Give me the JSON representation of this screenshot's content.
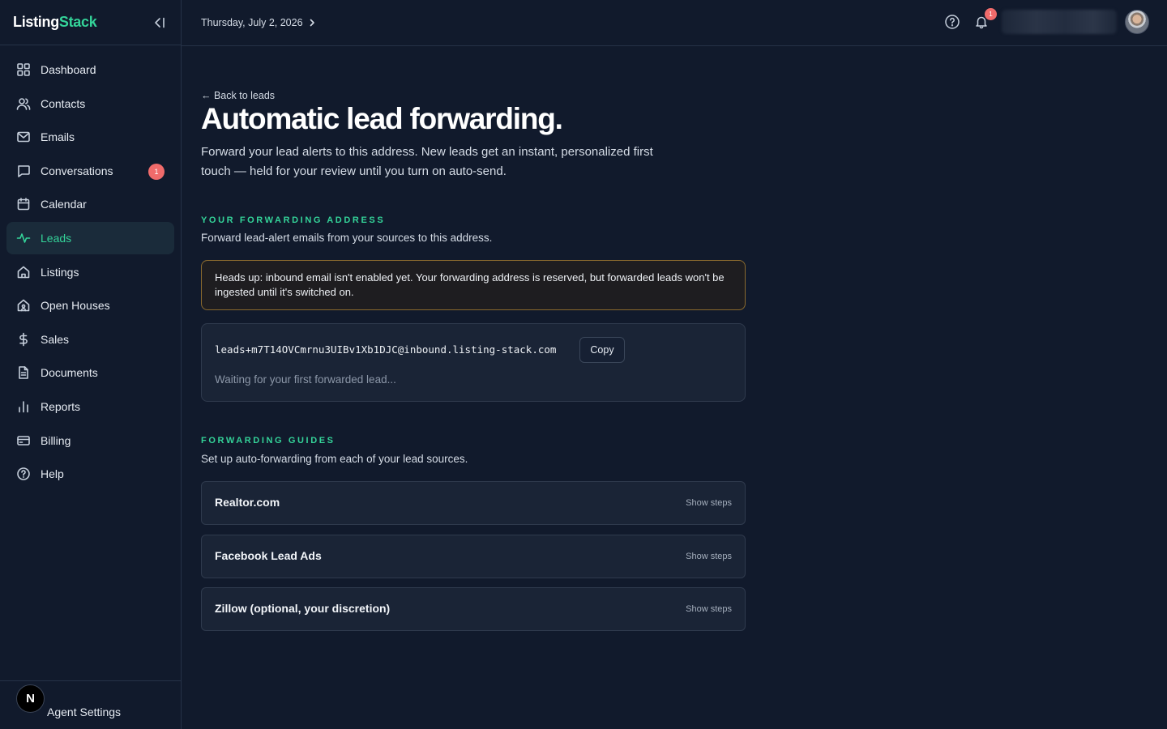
{
  "app": {
    "brand_part1": "Listing",
    "brand_part2": "Stack"
  },
  "sidebar": {
    "items": [
      {
        "label": "Dashboard",
        "icon": "grid-icon"
      },
      {
        "label": "Contacts",
        "icon": "users-icon"
      },
      {
        "label": "Emails",
        "icon": "mail-icon"
      },
      {
        "label": "Conversations",
        "icon": "chat-icon",
        "badge": "1"
      },
      {
        "label": "Calendar",
        "icon": "calendar-icon"
      },
      {
        "label": "Leads",
        "icon": "activity-icon",
        "active": true
      },
      {
        "label": "Listings",
        "icon": "home-icon"
      },
      {
        "label": "Open Houses",
        "icon": "open-house-icon"
      },
      {
        "label": "Sales",
        "icon": "dollar-icon"
      },
      {
        "label": "Documents",
        "icon": "document-icon"
      },
      {
        "label": "Reports",
        "icon": "bar-chart-icon"
      },
      {
        "label": "Billing",
        "icon": "credit-card-icon"
      },
      {
        "label": "Help",
        "icon": "help-circle-icon"
      }
    ],
    "footer": {
      "avatar_letter": "N",
      "label": "Agent Settings"
    }
  },
  "topbar": {
    "date": "Thursday, July 2, 2026",
    "notification_count": "1"
  },
  "main": {
    "back_link": "← Back to leads",
    "title": "Automatic lead forwarding.",
    "description": "Forward your lead alerts to this address. New leads get an instant, personalized first touch — held for your review until you turn on auto-send.",
    "forwarding": {
      "label": "YOUR FORWARDING ADDRESS",
      "subtitle": "Forward lead-alert emails from your sources to this address.",
      "warning": "Heads up: inbound email isn't enabled yet. Your forwarding address is reserved, but forwarded leads won't be ingested until it's switched on.",
      "address": "leads+m7T14OVCmrnu3UIBv1Xb1DJC@inbound.listing-stack.com",
      "copy_label": "Copy",
      "waiting": "Waiting for your first forwarded lead..."
    },
    "guides": {
      "label": "FORWARDING GUIDES",
      "subtitle": "Set up auto-forwarding from each of your lead sources.",
      "items": [
        {
          "name": "Realtor.com",
          "toggle": "Show steps"
        },
        {
          "name": "Facebook Lead Ads",
          "toggle": "Show steps"
        },
        {
          "name": "Zillow (optional, your discretion)",
          "toggle": "Show steps"
        }
      ]
    }
  },
  "colors": {
    "accent": "#34d399",
    "background": "#111a2c",
    "badge": "#f06b6b",
    "warning_border": "#8a6a2e"
  }
}
